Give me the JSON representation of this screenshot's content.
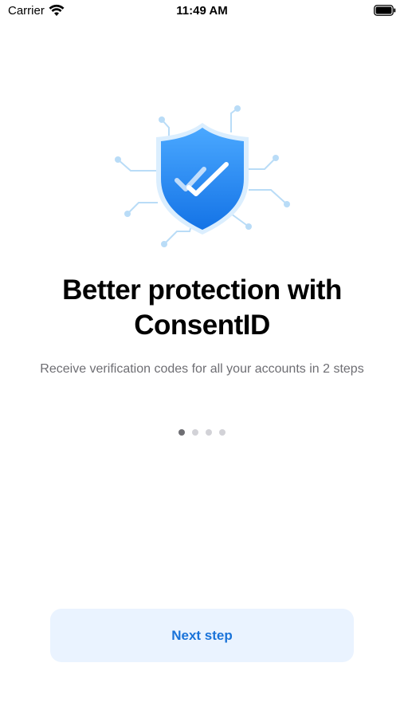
{
  "status_bar": {
    "carrier": "Carrier",
    "time": "11:49 AM",
    "icons": [
      "wifi-icon",
      "battery-icon"
    ]
  },
  "onboarding": {
    "illustration": "shield-check-icon",
    "title": "Better protection with ConsentID",
    "subtitle": "Receive verification codes for all your accounts in 2 steps",
    "page_indicator": {
      "total": 4,
      "current": 1
    },
    "next_button_label": "Next step"
  },
  "colors": {
    "accent": "#1a73d9",
    "button_bg": "#eaf3ff",
    "shield": "#2b8cff",
    "circuit": "#b9dcf7",
    "subtitle_text": "#6e6e73"
  }
}
